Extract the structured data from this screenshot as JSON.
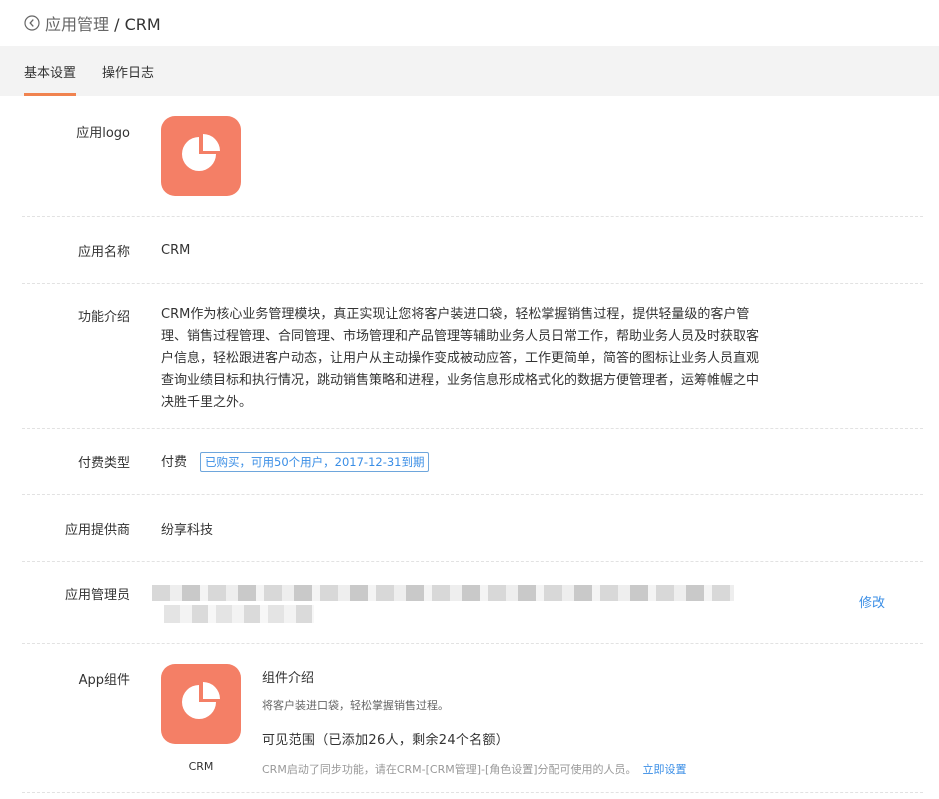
{
  "header": {
    "back_icon": "back-circle-icon",
    "crumb": "应用管理",
    "separator": " / ",
    "current": "CRM"
  },
  "tabs": [
    {
      "label": "基本设置",
      "active": true
    },
    {
      "label": "操作日志",
      "active": false
    }
  ],
  "colors": {
    "accent": "#f0834f",
    "logo_bg": "#f47f66",
    "link": "#3a8ee6"
  },
  "fields": {
    "logo": {
      "label": "应用logo",
      "icon": "pie-chart-icon"
    },
    "name": {
      "label": "应用名称",
      "value": "CRM"
    },
    "desc": {
      "label": "功能介绍",
      "value": "CRM作为核心业务管理模块，真正实现让您将客户装进口袋，轻松掌握销售过程，提供轻量级的客户管理、销售过程管理、合同管理、市场管理和产品管理等辅助业务人员日常工作，帮助业务人员及时获取客户信息，轻松跟进客户动态，让用户从主动操作变成被动应答，工作更简单，简答的图标让业务人员直观查询业绩目标和执行情况，跳动销售策略和进程，业务信息形成格式化的数据方便管理者，运筹帷幄之中决胜千里之外。"
    },
    "pay": {
      "label": "付费类型",
      "value": "付费",
      "badge": "已购买，可用50个用户，2017-12-31到期"
    },
    "vendor": {
      "label": "应用提供商",
      "value": "纷享科技"
    },
    "admin": {
      "label": "应用管理员",
      "edit": "修改"
    },
    "widget": {
      "label": "App组件",
      "icon": "pie-chart-icon",
      "caption": "CRM",
      "title": "组件介绍",
      "desc": "将客户装进口袋，轻松掌握销售过程。",
      "scope": "可见范围（已添加26人，剩余24个名额）",
      "note": "CRM启动了同步功能，请在CRM-[CRM管理]-[角色设置]分配可使用的人员。",
      "note_link": "立即设置"
    }
  }
}
